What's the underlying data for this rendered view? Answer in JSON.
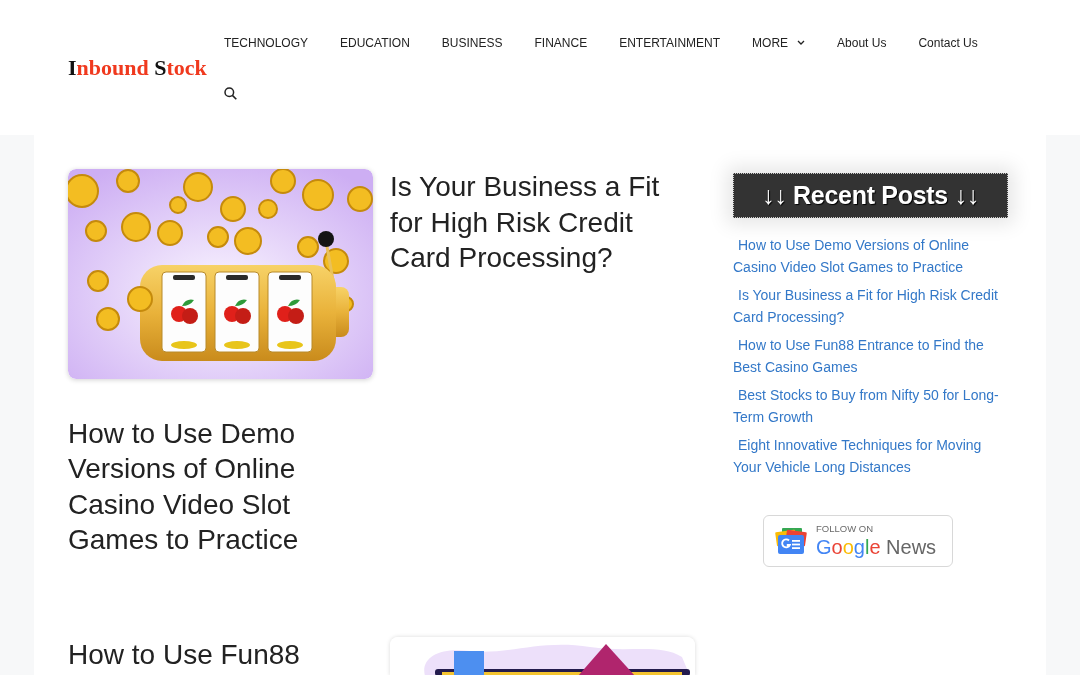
{
  "site": {
    "logo_words": [
      "Inbound",
      "Stock"
    ]
  },
  "nav": {
    "items": [
      {
        "label": "TECHNOLOGY",
        "kind": "link"
      },
      {
        "label": "EDUCATION",
        "kind": "link"
      },
      {
        "label": "BUSINESS",
        "kind": "link"
      },
      {
        "label": "FINANCE",
        "kind": "link"
      },
      {
        "label": "ENTERTAINMENT",
        "kind": "link"
      },
      {
        "label": "MORE",
        "kind": "dropdown"
      },
      {
        "label": "About Us",
        "kind": "link"
      },
      {
        "label": "Contact Us",
        "kind": "link"
      }
    ]
  },
  "posts": [
    {
      "kind": "slots",
      "title": "How to Use Demo Versions of Online Casino Video Slot Games to Practice"
    },
    {
      "kind": "text",
      "title": "Is Your Business a Fit for High Risk Credit Card Processing?"
    },
    {
      "kind": "text",
      "title": "How to Use Fun88"
    },
    {
      "kind": "trading"
    }
  ],
  "sidebar": {
    "heading": "↓↓ Recent Posts ↓↓",
    "recent_posts": [
      "How to Use Demo Versions of Online Casino Video Slot Games to Practice",
      "Is Your Business a Fit for High Risk Credit Card Processing?",
      "How to Use Fun88 Entrance to Find the Best Casino Games",
      "Best Stocks to Buy from Nifty 50 for Long-Term Growth",
      "Eight Innovative Techniques for Moving Your Vehicle Long Distances"
    ],
    "badge": {
      "caption": "FOLLOW ON",
      "brand": "Google",
      "product": "News"
    }
  }
}
